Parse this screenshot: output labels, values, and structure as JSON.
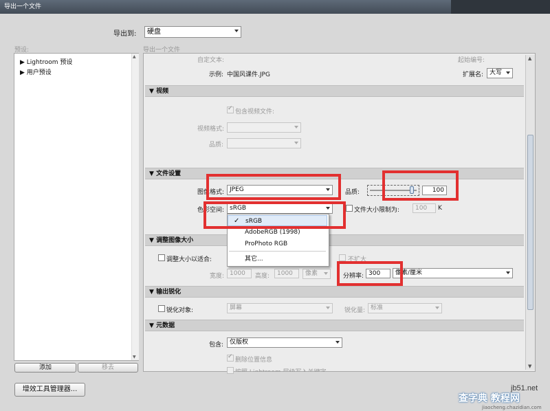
{
  "window": {
    "title": "导出一个文件"
  },
  "export_to": {
    "label": "导出到:",
    "value": "硬盘"
  },
  "presets": {
    "header": "预设:",
    "items": [
      {
        "label": "Lightroom 预设"
      },
      {
        "label": "用户预设"
      }
    ],
    "add_label": "添加",
    "remove_label": "移去"
  },
  "panel": {
    "header": "导出一个文件"
  },
  "naming": {
    "custom_text_label": "自定文本:",
    "start_number_label": "起始编号:",
    "example_label": "示例:",
    "example_value": "中国风课件.JPG",
    "extension_label": "扩展名:",
    "extension_value": "大写"
  },
  "video": {
    "title": "视频",
    "include_video_label": "包含视频文件:",
    "format_label": "视频格式:",
    "quality_label": "品质:"
  },
  "file_settings": {
    "title": "文件设置",
    "image_format_label": "图像格式:",
    "image_format_value": "JPEG",
    "quality_label": "品质:",
    "quality_value": "100",
    "quality_level": 100,
    "color_space_label": "色彩空间:",
    "color_space_value": "sRGB",
    "limit_size_label": "文件大小限制为:",
    "limit_size_value": "100",
    "limit_size_unit": "K"
  },
  "color_menu": {
    "items": [
      {
        "label": "sRGB",
        "checked": "✓"
      },
      {
        "label": "AdobeRGB (1998)"
      },
      {
        "label": "ProPhoto RGB"
      },
      {
        "label": "其它..."
      }
    ]
  },
  "resize": {
    "title": "调整图像大小",
    "fit_label": "调整大小以适合:",
    "dont_enlarge_label": "不扩大",
    "width_label": "宽度:",
    "width_value": "1000",
    "height_label": "高度:",
    "height_value": "1000",
    "unit_value": "像素",
    "resolution_label": "分辨率:",
    "resolution_value": "300",
    "resolution_unit": "像素/厘米"
  },
  "sharpen": {
    "title": "输出锐化",
    "sharpen_for_label": "锐化对象:",
    "sharpen_for_value": "屏幕",
    "amount_label": "锐化量:",
    "amount_value": "标准"
  },
  "metadata": {
    "title": "元数据",
    "include_label": "包含:",
    "include_value": "仅版权",
    "remove_location_label": "删除位置信息",
    "write_keywords_label": "按照 Lightroom 层级写入关键字"
  },
  "footer": {
    "plugin_manager_label": "增效工具管理器..."
  },
  "watermark": {
    "site": "jb51.net",
    "text": "查字典 教程网",
    "url": "jiaocheng.chazidian.com"
  },
  "colors": {
    "highlight": "#e23030",
    "titlebar": "#4f5966"
  }
}
